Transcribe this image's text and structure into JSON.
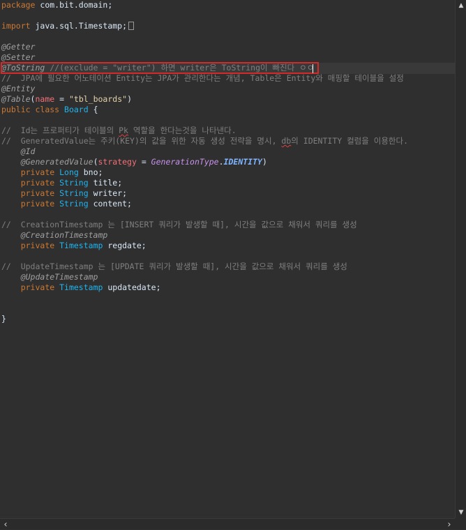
{
  "code": {
    "package_kw": "package",
    "package_name": " com.bit.domain;",
    "import_kw": "import",
    "import_name": " java.sql.Timestamp;",
    "getter": "@Getter",
    "setter": "@Setter",
    "tostring": "@ToString",
    "tostring_comment": " //(exclude = \"writer\") 하면 writer은 ToString이 빠진다 ㅇㅇ",
    "jpa_comment": "//  JPA에 필요한 어노테이션 Entity는 JPA가 관리한다는 개념, Table은 Entity와 매핑할 테이블을 설정",
    "entity": "@Entity",
    "table_anno": "@Table",
    "table_open": "(",
    "table_name_key": "name",
    "table_eq": " = ",
    "table_name_val": "\"tbl_boards\"",
    "table_close": ")",
    "public_kw": "public",
    "class_kw": " class ",
    "class_name": "Board",
    "class_open": " {",
    "id_comment_1": "//  Id는 프로퍼티가 테이블의 ",
    "id_comment_pk": "Pk",
    "id_comment_2": " 역할을 한다는것을 나타낸다.",
    "gen_comment_1": "//  GeneratedValue는 주키(KEY)의 값을 위한 자동 생성 전략을 명시, ",
    "gen_comment_db": "db",
    "gen_comment_2": "의 IDENTITY 컬럼을 이용한다.",
    "id_anno": "@Id",
    "genval_anno": "@GeneratedValue",
    "genval_open": "(",
    "strategy_key": "strategy",
    "genval_eq": " = ",
    "gen_type": "GenerationType",
    "dot": ".",
    "identity": "IDENTITY",
    "genval_close": ")",
    "fields": [
      {
        "mod": "private",
        "type": "Long",
        "name": " bno;"
      },
      {
        "mod": "private",
        "type": "String",
        "name": " title;"
      },
      {
        "mod": "private",
        "type": "String",
        "name": " writer;"
      },
      {
        "mod": "private",
        "type": "String",
        "name": " content;"
      }
    ],
    "creation_comment": "//  CreationTimestamp 는 [INSERT 쿼리가 발생할 때], 시간을 값으로 채워서 쿼리를 생성",
    "creation_anno": "@CreationTimestamp",
    "regdate_mod": "private",
    "regdate_type": "Timestamp",
    "regdate_name": " regdate;",
    "update_comment": "//  UpdateTimestamp 는 [UPDATE 쿼리가 발생할 때], 시간을 값으로 채워서 쿼리를 생성",
    "update_anno": "@UpdateTimestamp",
    "updatedate_mod": "private",
    "updatedate_type": "Timestamp",
    "updatedate_name": " updatedate;",
    "class_end": "}"
  },
  "icons": {
    "scroll_up": "scroll-up-arrow-icon",
    "scroll_down": "scroll-down-arrow-icon",
    "scroll_left": "scroll-left-arrow-icon",
    "scroll_right": "scroll-right-arrow-icon"
  },
  "colors": {
    "background": "#2f2f2f",
    "keyword": "#cc7832",
    "type": "#1eb5f0",
    "string": "#e3d3ac",
    "comment": "#7f7f7f",
    "annotation": "#a0a0a0",
    "highlight_border": "#d52a2a"
  }
}
